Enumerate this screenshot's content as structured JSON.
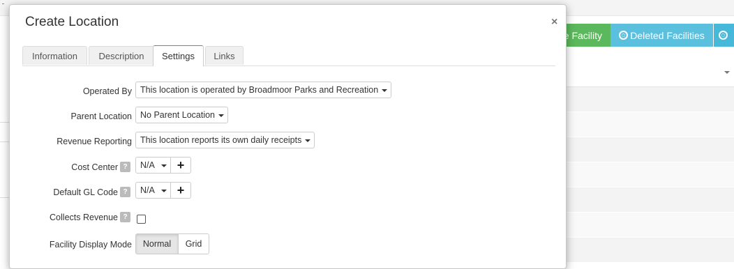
{
  "background": {
    "buttons": {
      "add_facility": "e Facility",
      "deleted_facilities": "Deleted Facilities"
    },
    "colors": {
      "green": "#5cb85c",
      "teal": "#5bc0de"
    }
  },
  "modal": {
    "title": "Create Location",
    "close_glyph": "×",
    "tabs": [
      {
        "label": "Information"
      },
      {
        "label": "Description"
      },
      {
        "label": "Settings",
        "active": true
      },
      {
        "label": "Links"
      }
    ],
    "fields": {
      "operated_by": {
        "label": "Operated By",
        "value": "This location is operated by Broadmoor Parks and Recreation"
      },
      "parent_location": {
        "label": "Parent Location",
        "value": "No Parent Location"
      },
      "revenue_reporting": {
        "label": "Revenue Reporting",
        "value": "This location reports its own daily receipts"
      },
      "cost_center": {
        "label": "Cost Center",
        "help": "?",
        "value": "N/A",
        "add": "+"
      },
      "default_gl_code": {
        "label": "Default GL Code",
        "help": "?",
        "value": "N/A",
        "add": "+"
      },
      "collects_revenue": {
        "label": "Collects Revenue",
        "help": "?",
        "checked": false
      },
      "facility_display_mode": {
        "label": "Facility Display Mode",
        "options": [
          "Normal",
          "Grid"
        ],
        "selected": "Normal"
      }
    }
  }
}
